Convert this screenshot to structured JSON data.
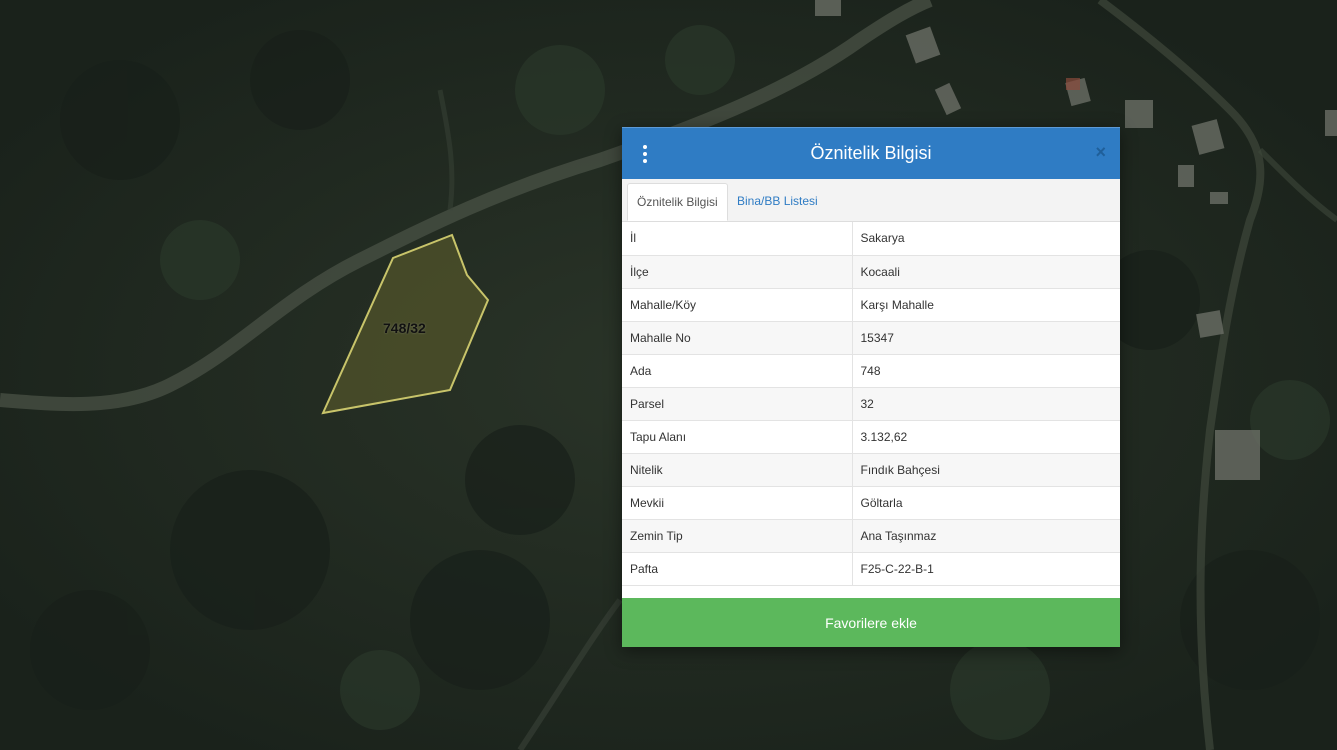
{
  "map": {
    "parcel_label": "748/32"
  },
  "dialog": {
    "title": "Öznitelik Bilgisi",
    "close_symbol": "×",
    "tabs": [
      {
        "label": "Öznitelik Bilgisi",
        "active": true
      },
      {
        "label": "Bina/BB Listesi",
        "active": false
      }
    ],
    "rows": [
      {
        "key": "İl",
        "value": "Sakarya"
      },
      {
        "key": "İlçe",
        "value": "Kocaali"
      },
      {
        "key": "Mahalle/Köy",
        "value": "Karşı Mahalle"
      },
      {
        "key": "Mahalle No",
        "value": "15347"
      },
      {
        "key": "Ada",
        "value": "748"
      },
      {
        "key": "Parsel",
        "value": "32"
      },
      {
        "key": "Tapu Alanı",
        "value": "3.132,62"
      },
      {
        "key": "Nitelik",
        "value": "Fındık Bahçesi"
      },
      {
        "key": "Mevkii",
        "value": "Göltarla"
      },
      {
        "key": "Zemin Tip",
        "value": "Ana Taşınmaz"
      },
      {
        "key": "Pafta",
        "value": "F25-C-22-B-1"
      }
    ],
    "favorite_button": "Favorilere ekle"
  },
  "colors": {
    "header": "#2f7cc4",
    "button": "#5cb85c",
    "parcel_outline": "#c8c46a"
  },
  "icons": {
    "menu": "vertical-dots-icon",
    "close": "close-icon"
  }
}
